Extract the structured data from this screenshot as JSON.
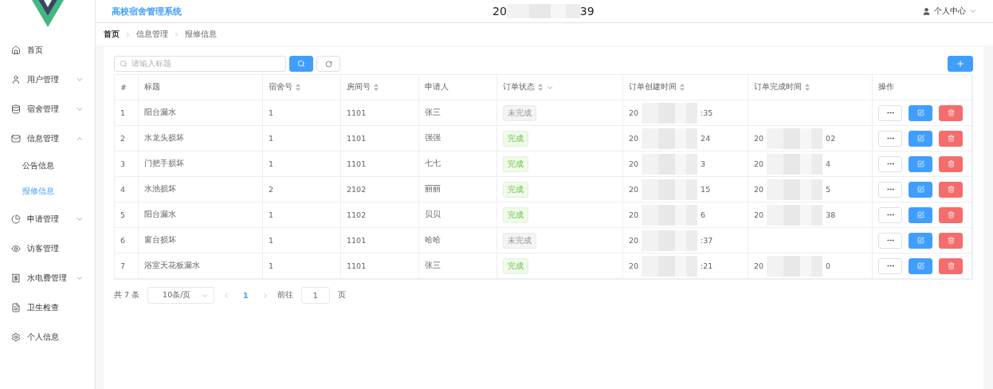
{
  "sidebar": {
    "items": [
      {
        "label": "首页",
        "selected": false
      },
      {
        "label": "用户管理",
        "selected": false,
        "expanded": false
      },
      {
        "label": "宿舍管理",
        "selected": false,
        "expanded": false
      },
      {
        "label": "信息管理",
        "selected": false,
        "expanded": true,
        "children": [
          {
            "label": "公告信息",
            "selected": false
          },
          {
            "label": "报修信息",
            "selected": true
          }
        ]
      },
      {
        "label": "申请管理",
        "selected": false,
        "expanded": false
      },
      {
        "label": "访客管理",
        "selected": false
      },
      {
        "label": "水电费管理",
        "selected": false,
        "expanded": false
      },
      {
        "label": "卫生检查",
        "selected": false
      },
      {
        "label": "个人信息",
        "selected": false
      }
    ]
  },
  "header": {
    "title": "高校宿舍管理系统",
    "clock_start": "20",
    "clock_end": "39",
    "user_menu": "个人中心"
  },
  "breadcrumb": [
    "首页",
    "信息管理",
    "报修信息"
  ],
  "search": {
    "placeholder": "请输入标题"
  },
  "table": {
    "columns": [
      {
        "label": "#",
        "sortable": false,
        "filter": false
      },
      {
        "label": "标题",
        "sortable": false,
        "filter": false
      },
      {
        "label": "宿舍号",
        "sortable": true,
        "filter": false
      },
      {
        "label": "房间号",
        "sortable": true,
        "filter": false
      },
      {
        "label": "申请人",
        "sortable": false,
        "filter": false
      },
      {
        "label": "订单状态",
        "sortable": true,
        "filter": true
      },
      {
        "label": "订单创建时间",
        "sortable": true,
        "filter": false
      },
      {
        "label": "订单完成时间",
        "sortable": true,
        "filter": false
      },
      {
        "label": "操作",
        "sortable": false,
        "filter": false
      }
    ],
    "rows": [
      {
        "index": "1",
        "title": "阳台漏水",
        "dorm": "1",
        "room": "1101",
        "applicant": "张三",
        "status": {
          "text": "未完成",
          "kind": "pending"
        },
        "created": [
          "20",
          ":35"
        ]
      },
      {
        "index": "2",
        "title": "水龙头损坏",
        "dorm": "1",
        "room": "1101",
        "applicant": "强强",
        "status": {
          "text": "完成",
          "kind": "done"
        },
        "created": [
          "20",
          "24"
        ],
        "finished": [
          "20",
          "02"
        ]
      },
      {
        "index": "3",
        "title": "门把手损坏",
        "dorm": "1",
        "room": "1101",
        "applicant": "七七",
        "status": {
          "text": "完成",
          "kind": "done"
        },
        "created": [
          "20",
          "3"
        ],
        "finished": [
          "20",
          "4"
        ]
      },
      {
        "index": "4",
        "title": "水池损坏",
        "dorm": "2",
        "room": "2102",
        "applicant": "丽丽",
        "status": {
          "text": "完成",
          "kind": "done"
        },
        "created": [
          "20",
          "15"
        ],
        "finished": [
          "20",
          "5"
        ]
      },
      {
        "index": "5",
        "title": "阳台漏水",
        "dorm": "1",
        "room": "1102",
        "applicant": "贝贝",
        "status": {
          "text": "完成",
          "kind": "done"
        },
        "created": [
          "20",
          "6"
        ],
        "finished": [
          "20",
          "38"
        ]
      },
      {
        "index": "6",
        "title": "窗台损坏",
        "dorm": "1",
        "room": "1101",
        "applicant": "哈哈",
        "status": {
          "text": "未完成",
          "kind": "pending"
        },
        "created": [
          "20",
          ":37"
        ]
      },
      {
        "index": "7",
        "title": "浴室天花板漏水",
        "dorm": "1",
        "room": "1101",
        "applicant": "张三",
        "status": {
          "text": "完成",
          "kind": "done"
        },
        "created": [
          "20",
          ":21"
        ],
        "finished": [
          "20",
          "0"
        ]
      }
    ]
  },
  "pagination": {
    "total": "共 7 条",
    "page_size": "10条/页",
    "pages": [
      {
        "label": "1",
        "selected": true
      }
    ],
    "goto_label": "前往",
    "goto_value": "1",
    "goto_suffix": "页"
  }
}
